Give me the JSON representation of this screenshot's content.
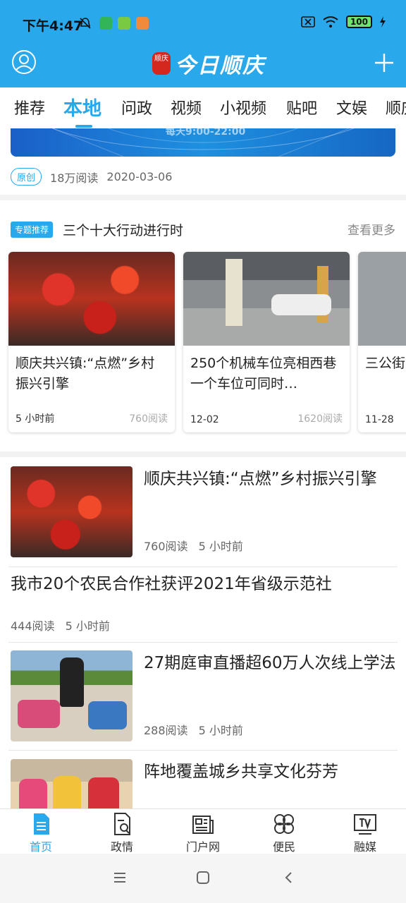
{
  "status_bar": {
    "time": "下午4:47",
    "battery": "100"
  },
  "header": {
    "logo_seal": "顺庆",
    "app_title": "今日顺庆"
  },
  "tabs": [
    {
      "label": "推荐"
    },
    {
      "label": "本地"
    },
    {
      "label": "问政"
    },
    {
      "label": "视频"
    },
    {
      "label": "小视频"
    },
    {
      "label": "贴吧"
    },
    {
      "label": "文娱"
    },
    {
      "label": "顺庆"
    }
  ],
  "active_tab": "本地",
  "top_article": {
    "banner_text": "每天9:00-22:00",
    "badge": "原创",
    "reads": "18万阅读",
    "date": "2020-03-06"
  },
  "special": {
    "tag": "专题推荐",
    "title": "三个十大行动进行时",
    "more": "查看更多",
    "cards": [
      {
        "title": "顺庆共兴镇:“点燃”乡村振兴引擎",
        "date": "5 小时前",
        "reads": "760阅读"
      },
      {
        "title": "250个机械车位亮相西巷　一个车位可同时…",
        "date": "12-02",
        "reads": "1620阅读"
      },
      {
        "title": "三公街文化 城",
        "date": "11-28",
        "reads": ""
      }
    ]
  },
  "news": [
    {
      "title": "顺庆共兴镇:“点燃”乡村振兴引擎",
      "reads": "760阅读",
      "time": "5 小时前"
    },
    {
      "title": "我市20个农民合作社获评2021年省级示范社",
      "reads": "444阅读",
      "time": "5 小时前"
    },
    {
      "title": "27期庭审直播超60万人次线上学法",
      "reads": "288阅读",
      "time": "5 小时前"
    },
    {
      "title": "阵地覆盖城乡共享文化芬芳",
      "reads": "",
      "time": ""
    }
  ],
  "bottom_nav": [
    {
      "label": "首页"
    },
    {
      "label": "政情"
    },
    {
      "label": "门户网"
    },
    {
      "label": "便民"
    },
    {
      "label": "融媒"
    }
  ],
  "colors": {
    "brand": "#2aa8ec",
    "seal": "#d4271d"
  }
}
